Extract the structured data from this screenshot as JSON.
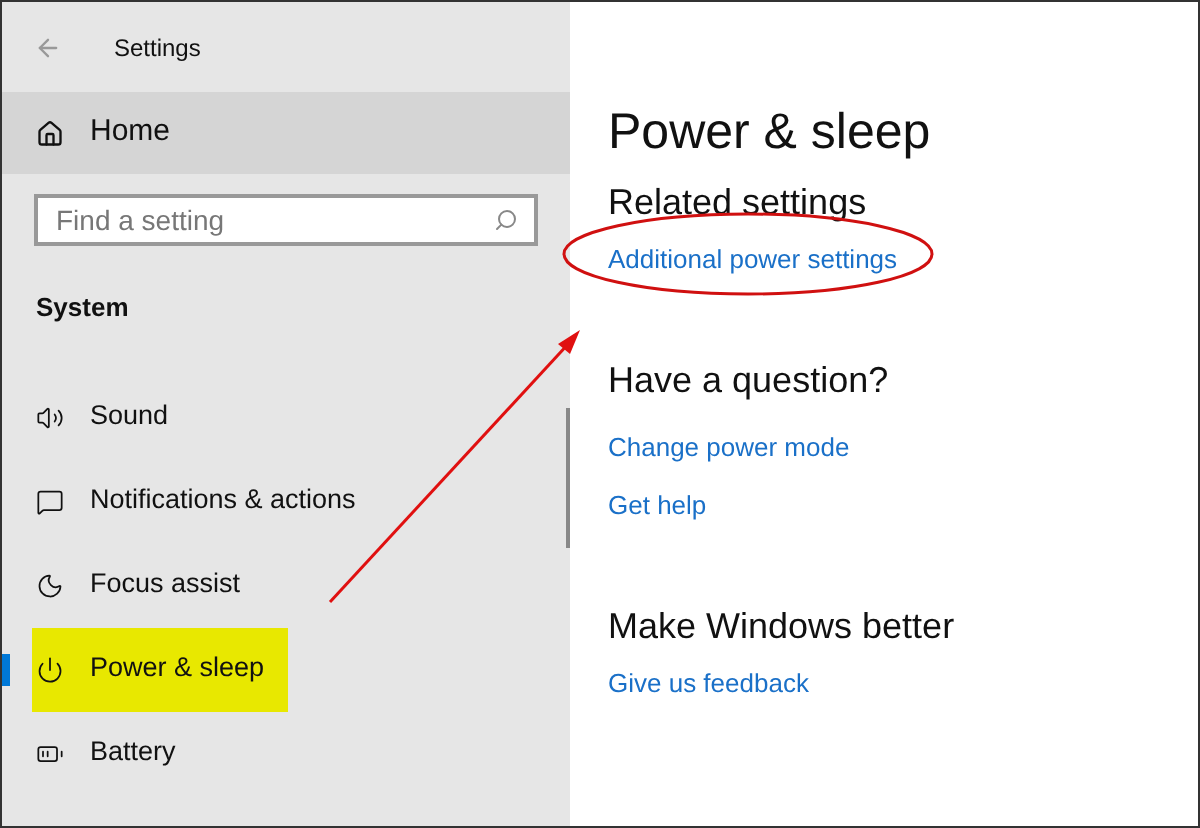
{
  "window": {
    "title": "Settings"
  },
  "sidebar": {
    "home": "Home",
    "search": {
      "placeholder": "Find a setting"
    },
    "section": "System",
    "items": [
      {
        "label": "Sound",
        "kind": "sound",
        "selected": false,
        "highlighted": false
      },
      {
        "label": "Notifications & actions",
        "kind": "notifications",
        "selected": false,
        "highlighted": false
      },
      {
        "label": "Focus assist",
        "kind": "focus",
        "selected": false,
        "highlighted": false
      },
      {
        "label": "Power & sleep",
        "kind": "power",
        "selected": true,
        "highlighted": true
      },
      {
        "label": "Battery",
        "kind": "battery",
        "selected": false,
        "highlighted": false
      }
    ]
  },
  "page": {
    "title": "Power & sleep",
    "sections": [
      {
        "heading": "Related settings",
        "links": [
          {
            "label": "Additional power settings",
            "circled": true
          }
        ]
      },
      {
        "heading": "Have a question?",
        "links": [
          {
            "label": "Change power mode",
            "circled": false
          },
          {
            "label": "Get help",
            "circled": false
          }
        ]
      },
      {
        "heading": "Make Windows better",
        "links": [
          {
            "label": "Give us feedback",
            "circled": false
          }
        ]
      }
    ]
  }
}
